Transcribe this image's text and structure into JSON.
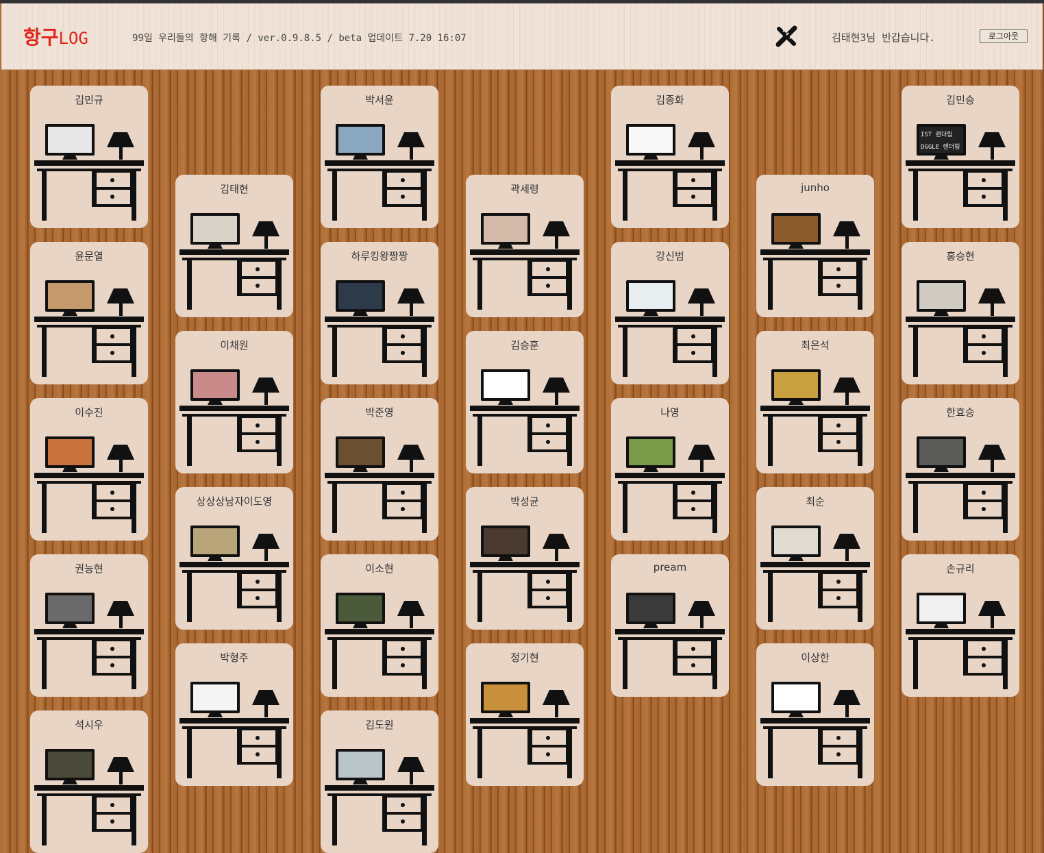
{
  "header": {
    "logo_main": "항구",
    "logo_suffix": "LOG",
    "subtitle": "99일 우리들의 항해 기록 / ver.0.9.8.5 / beta 업데이트 7.20 16:07",
    "edit_icon": "pen-ruler-icon",
    "greeting": "김태현3님 반갑습니다.",
    "logout_label": "로그아웃"
  },
  "colors": {
    "logo": "#e0241b",
    "card": "#e9d5c6",
    "floor": "#b06e36"
  },
  "monitor_text": {
    "line1": "IST 렌더링 ",
    "line2": "DGGLE 렌더링"
  },
  "desks": [
    {
      "name": "김민규",
      "screen": "#e8e8e8"
    },
    {
      "name": "윤문열",
      "screen": "#c49a6c"
    },
    {
      "name": "이수진",
      "screen": "#c8733d"
    },
    {
      "name": "권능현",
      "screen": "#6a6a6a"
    },
    {
      "name": "석시우",
      "screen": "#4a4a3a"
    },
    {
      "name": "김태현",
      "screen": "#d9d2c8"
    },
    {
      "name": "이채원",
      "screen": "#c98a8a"
    },
    {
      "name": "상상상남자이도영",
      "screen": "#b9a57a"
    },
    {
      "name": "박형주",
      "screen": "#f4f4f4"
    },
    {
      "name": "박서윤",
      "screen": "#8aa7c0"
    },
    {
      "name": "하루킹왕짱짱",
      "screen": "#2d3a4a"
    },
    {
      "name": "박준영",
      "screen": "#6a5030"
    },
    {
      "name": "이소현",
      "screen": "#4c5a3c"
    },
    {
      "name": "김도원",
      "screen": "#b9c4c8"
    },
    {
      "name": "곽세령",
      "screen": "#d2b9a8"
    },
    {
      "name": "김승훈",
      "screen": "#ffffff"
    },
    {
      "name": "박성균",
      "screen": "#4a3a30"
    },
    {
      "name": "정기현",
      "screen": "#c8903a"
    },
    {
      "name": "김종화",
      "screen": "#f8f8f8"
    },
    {
      "name": "강신범",
      "screen": "#e8eef0"
    },
    {
      "name": "나영",
      "screen": "#7a9a4a"
    },
    {
      "name": "pream",
      "screen": "#3a3a3a"
    },
    {
      "name": "junho",
      "screen": "#8a5a2a"
    },
    {
      "name": "최은석",
      "screen": "#c8a040"
    },
    {
      "name": "최순",
      "screen": "#e0dcd4"
    },
    {
      "name": "이상한",
      "screen": "#ffffff"
    },
    {
      "name": "김민승",
      "screen": "#222222"
    },
    {
      "name": "홍승현",
      "screen": "#cfcac2"
    },
    {
      "name": "한효승",
      "screen": "#5a5a58"
    },
    {
      "name": "손규리",
      "screen": "#f0f0f0"
    }
  ]
}
